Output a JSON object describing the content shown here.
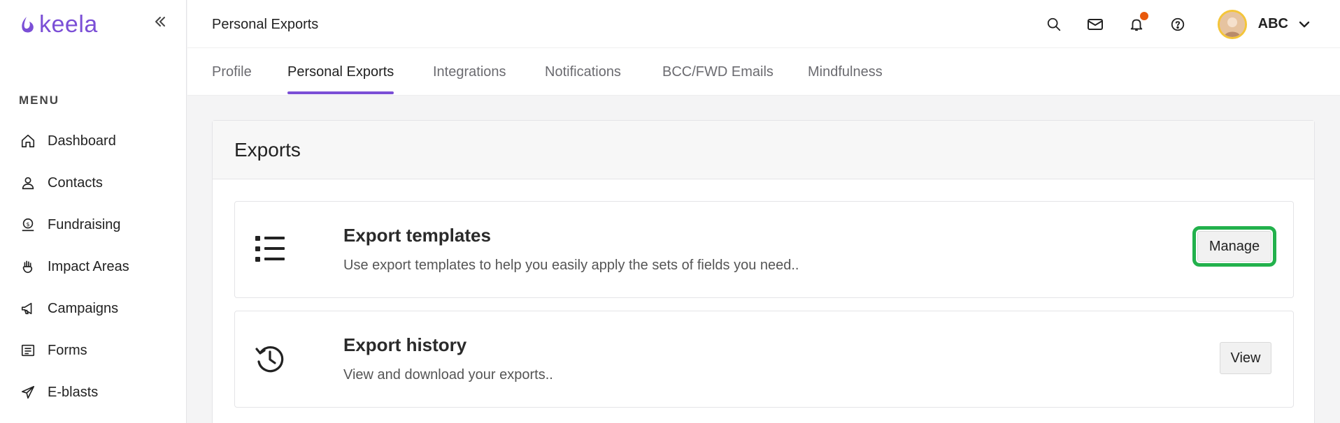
{
  "brand": {
    "name": "keela",
    "color": "#7b4fd6"
  },
  "sidebar": {
    "menu_heading": "MENU",
    "items": [
      {
        "label": "Dashboard",
        "icon": "home-icon"
      },
      {
        "label": "Contacts",
        "icon": "person-icon"
      },
      {
        "label": "Fundraising",
        "icon": "money-bag-icon"
      },
      {
        "label": "Impact Areas",
        "icon": "hand-icon"
      },
      {
        "label": "Campaigns",
        "icon": "megaphone-icon"
      },
      {
        "label": "Forms",
        "icon": "form-list-icon"
      },
      {
        "label": "E-blasts",
        "icon": "paper-plane-icon"
      }
    ]
  },
  "header": {
    "title": "Personal Exports",
    "user_name": "ABC",
    "notification_dot_color": "#e8590c"
  },
  "tabs": [
    {
      "label": "Profile",
      "active": false
    },
    {
      "label": "Personal Exports",
      "active": true
    },
    {
      "label": "Integrations",
      "active": false
    },
    {
      "label": "Notifications",
      "active": false
    },
    {
      "label": "BCC/FWD Emails",
      "active": false
    },
    {
      "label": "Mindfulness",
      "active": false
    }
  ],
  "exports": {
    "title": "Exports",
    "rows": [
      {
        "title": "Export templates",
        "description": "Use export templates to help you easily apply the sets of fields you need..",
        "button": "Manage",
        "icon": "list-icon",
        "highlight_color": "#22b14c"
      },
      {
        "title": "Export history",
        "description": "View and download your exports..",
        "button": "View",
        "icon": "history-icon"
      }
    ]
  }
}
